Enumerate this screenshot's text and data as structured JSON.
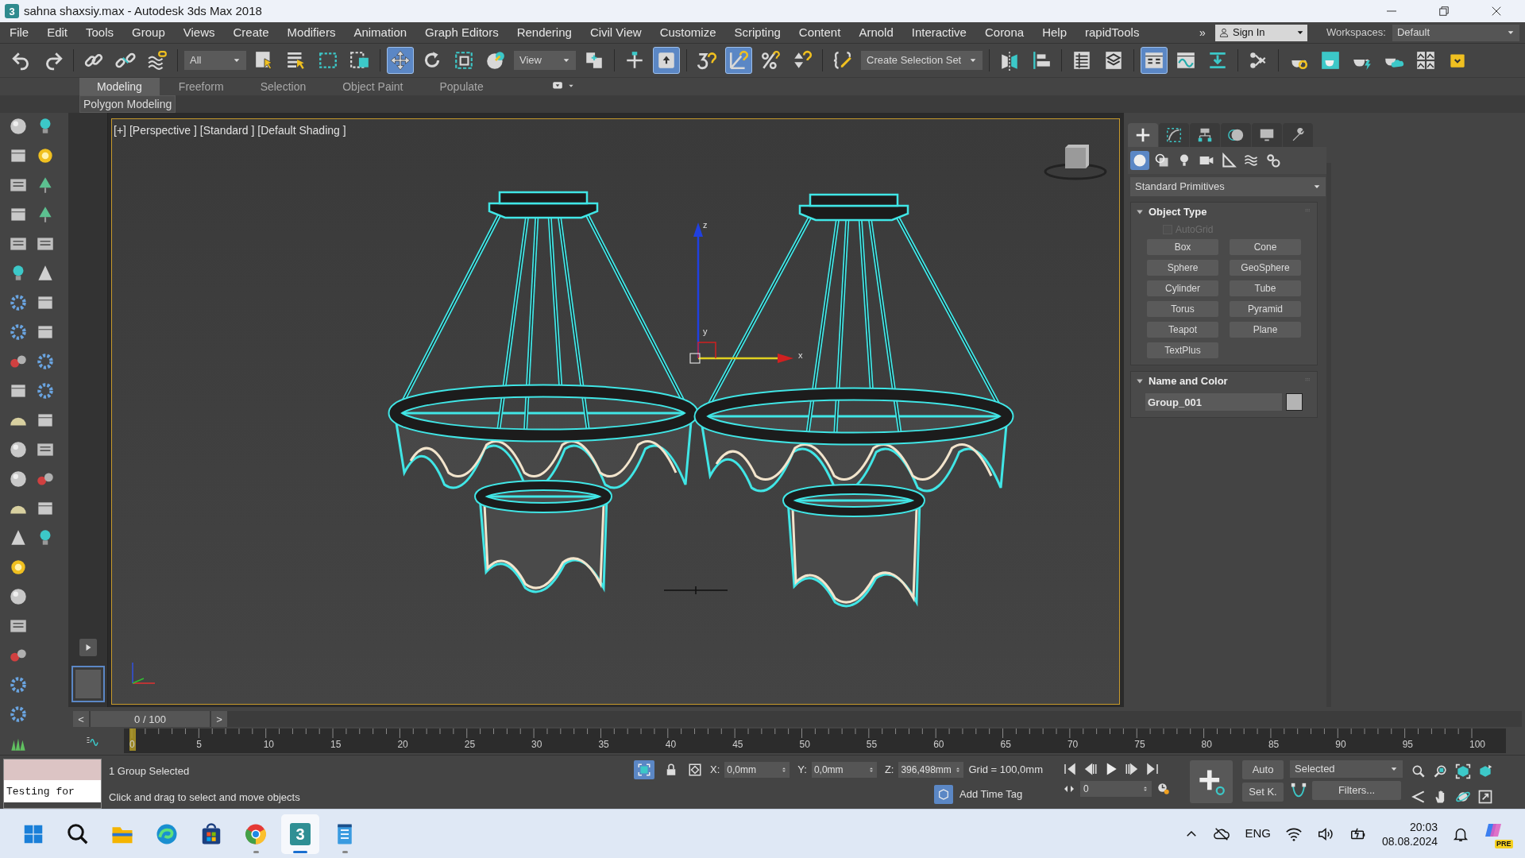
{
  "window": {
    "title": "sahna shaxsiy.max - Autodesk 3ds Max 2018",
    "icon_text": "3"
  },
  "menu": [
    "File",
    "Edit",
    "Tools",
    "Group",
    "Views",
    "Create",
    "Modifiers",
    "Animation",
    "Graph Editors",
    "Rendering",
    "Civil View",
    "Customize",
    "Scripting",
    "Content",
    "Arnold",
    "Interactive",
    "Corona",
    "Help",
    "rapidTools"
  ],
  "menu_overflow": "»",
  "sign_in": "Sign In",
  "workspaces": {
    "label": "Workspaces:",
    "value": "Default"
  },
  "toolbar_groups": [
    [
      {
        "kind": "undo",
        "selected": false
      },
      {
        "kind": "redo",
        "selected": false
      }
    ],
    [
      {
        "kind": "link",
        "selected": false
      },
      {
        "kind": "unlink",
        "selected": false
      },
      {
        "kind": "bind",
        "selected": false
      }
    ],
    [
      {
        "kind": "dropdown",
        "value": "All",
        "selected": false
      },
      {
        "kind": "select",
        "selected": false
      },
      {
        "kind": "select_by_name",
        "selected": false
      },
      {
        "kind": "region",
        "selected": false
      },
      {
        "kind": "crossing",
        "selected": false
      }
    ],
    [
      {
        "kind": "move",
        "selected": true
      },
      {
        "kind": "rotate",
        "selected": false
      },
      {
        "kind": "scale",
        "selected": false
      },
      {
        "kind": "place",
        "selected": false
      },
      {
        "kind": "dropdown",
        "value": "View",
        "selected": false
      },
      {
        "kind": "pivot",
        "selected": false
      }
    ],
    [
      {
        "kind": "manipulate",
        "selected": false
      },
      {
        "kind": "shortcut",
        "selected": true
      }
    ],
    [
      {
        "kind": "snap",
        "selected": false
      },
      {
        "kind": "angle_snap",
        "selected": true
      },
      {
        "kind": "percent_snap",
        "selected": false
      },
      {
        "kind": "spinner_snap",
        "selected": false
      }
    ],
    [
      {
        "kind": "named_sets",
        "selected": false
      },
      {
        "kind": "dropdown",
        "value": "Create Selection Set",
        "selected": false
      }
    ],
    [
      {
        "kind": "mirror",
        "selected": false
      },
      {
        "kind": "align",
        "selected": false
      }
    ],
    [
      {
        "kind": "explorer",
        "selected": false
      },
      {
        "kind": "layers",
        "selected": false
      }
    ],
    [
      {
        "kind": "ribbon",
        "selected": true
      },
      {
        "kind": "curves",
        "selected": false
      },
      {
        "kind": "dope",
        "selected": false
      }
    ],
    [
      {
        "kind": "schematic",
        "selected": false
      }
    ],
    [
      {
        "kind": "render_setup",
        "selected": false
      },
      {
        "kind": "frame_window",
        "selected": false
      },
      {
        "kind": "render",
        "selected": false
      },
      {
        "kind": "cloud",
        "selected": false
      },
      {
        "kind": "grid",
        "selected": false
      },
      {
        "kind": "note",
        "selected": false
      }
    ]
  ],
  "ribbon": {
    "tabs": [
      {
        "label": "Modeling",
        "selected": true
      },
      {
        "label": "Freeform",
        "selected": false
      },
      {
        "label": "Selection",
        "selected": false
      },
      {
        "label": "Object Paint",
        "selected": false
      },
      {
        "label": "Populate",
        "selected": false
      }
    ],
    "panel": "Polygon Modeling"
  },
  "viewport": {
    "labels": [
      "[+]",
      "[Perspective ]",
      "[Standard ]",
      "[Default Shading ]"
    ],
    "gizmo_axes": [
      "z",
      "y",
      "x"
    ]
  },
  "command_panel": {
    "tabs": [
      {
        "kind": "create",
        "selected": true
      },
      {
        "kind": "modify",
        "selected": false
      },
      {
        "kind": "hierarchy",
        "selected": false
      },
      {
        "kind": "motion",
        "selected": false
      },
      {
        "kind": "display",
        "selected": false
      },
      {
        "kind": "utilities",
        "selected": false
      }
    ],
    "categories": [
      {
        "kind": "geometry",
        "selected": true
      },
      {
        "kind": "shapes",
        "selected": false
      },
      {
        "kind": "lights",
        "selected": false
      },
      {
        "kind": "cameras",
        "selected": false
      },
      {
        "kind": "helpers",
        "selected": false
      },
      {
        "kind": "spacewarps",
        "selected": false
      },
      {
        "kind": "systems",
        "selected": false
      }
    ],
    "dropdown": "Standard Primitives",
    "rollouts": [
      {
        "kind": "object_type",
        "title": "Object Type",
        "expanded": true,
        "autogrid": {
          "label": "AutoGrid",
          "checked": false,
          "disabled": true
        },
        "buttons": [
          "Box",
          "Cone",
          "Sphere",
          "GeoSphere",
          "Cylinder",
          "Tube",
          "Torus",
          "Pyramid",
          "Teapot",
          "Plane",
          "TextPlus"
        ]
      },
      {
        "kind": "name_color",
        "title": "Name and Color",
        "expanded": true,
        "name": "Group_001"
      }
    ]
  },
  "time_slider": {
    "prev": "<",
    "frame": "0 / 100",
    "next": ">",
    "level": 0
  },
  "track_labels": [
    "0",
    "5",
    "10",
    "15",
    "20",
    "25",
    "30",
    "35",
    "40",
    "45",
    "50",
    "55",
    "60",
    "65",
    "70",
    "75",
    "80",
    "85",
    "90",
    "95",
    "100"
  ],
  "status": {
    "listener": "Testing for",
    "selection": "1 Group Selected",
    "prompt": "Click and drag to select and move objects",
    "coords": [
      {
        "label": "X:",
        "value": "0,0mm"
      },
      {
        "label": "Y:",
        "value": "0,0mm"
      },
      {
        "label": "Z:",
        "value": "396,498mm"
      }
    ],
    "grid": "Grid = 100,0mm",
    "time_tag": "Add Time Tag",
    "frame": "0",
    "auto_key": {
      "label": "Auto",
      "on": false
    },
    "set_key": "Set K.",
    "key_filter": "Selected",
    "filters": "Filters..."
  },
  "taskbar": {
    "apps": [
      {
        "kind": "start",
        "selected": false,
        "running": false
      },
      {
        "kind": "search",
        "selected": false,
        "running": false
      },
      {
        "kind": "files",
        "selected": false,
        "running": false
      },
      {
        "kind": "edge",
        "selected": false,
        "running": false
      },
      {
        "kind": "store",
        "selected": false,
        "running": false
      },
      {
        "kind": "chrome",
        "selected": false,
        "running": true
      },
      {
        "kind": "max",
        "selected": true,
        "running": true,
        "icon_text": "3"
      },
      {
        "kind": "notepad",
        "selected": false,
        "running": true
      }
    ],
    "language": "ENG",
    "time": "20:03",
    "date": "08.08.2024",
    "copilot_badge": "PRE"
  }
}
